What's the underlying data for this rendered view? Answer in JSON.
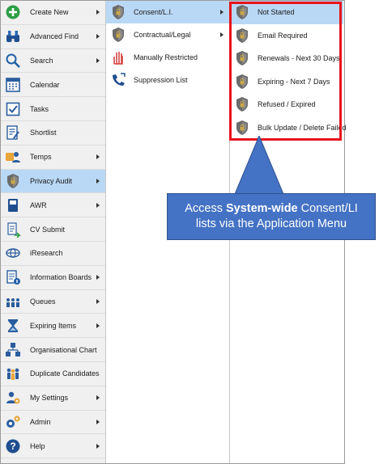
{
  "colors": {
    "selected": "#b9d8f5",
    "highlight_box": "#e8131c",
    "callout_bg": "#4472c4",
    "shield": "#6b6b6b"
  },
  "menu": [
    {
      "label": "Create New",
      "icon": "plus-circle-icon",
      "arrow": true
    },
    {
      "label": "Advanced Find",
      "icon": "binoculars-icon",
      "arrow": true
    },
    {
      "label": "Search",
      "icon": "magnifier-icon",
      "arrow": true
    },
    {
      "label": "Calendar",
      "icon": "calendar-icon",
      "arrow": false
    },
    {
      "label": "Tasks",
      "icon": "checkbox-icon",
      "arrow": false
    },
    {
      "label": "Shortlist",
      "icon": "shortlist-icon",
      "arrow": false
    },
    {
      "label": "Temps",
      "icon": "temps-icon",
      "arrow": true
    },
    {
      "label": "Privacy Audit",
      "icon": "shield-icon",
      "arrow": true,
      "selected": true
    },
    {
      "label": "AWR",
      "icon": "book-icon",
      "arrow": true
    },
    {
      "label": "CV Submit",
      "icon": "cv-submit-icon",
      "arrow": false
    },
    {
      "label": "iResearch",
      "icon": "globe-icon",
      "arrow": false
    },
    {
      "label": "Information Boards",
      "icon": "info-board-icon",
      "arrow": true
    },
    {
      "label": "Queues",
      "icon": "queue-icon",
      "arrow": true
    },
    {
      "label": "Expiring Items",
      "icon": "hourglass-icon",
      "arrow": true
    },
    {
      "label": "Organisational Chart",
      "icon": "org-chart-icon",
      "arrow": false
    },
    {
      "label": "Duplicate Candidates",
      "icon": "duplicate-people-icon",
      "arrow": false
    },
    {
      "label": "My Settings",
      "icon": "person-gear-icon",
      "arrow": true
    },
    {
      "label": "Admin",
      "icon": "gears-icon",
      "arrow": true
    },
    {
      "label": "Help",
      "icon": "help-icon",
      "arrow": true
    }
  ],
  "submenu": [
    {
      "label": "Consent/L.I.",
      "icon": "shield-icon",
      "arrow": true,
      "selected": true
    },
    {
      "label": "Contractual/Legal",
      "icon": "shield-icon",
      "arrow": true
    },
    {
      "label": "Manually Restricted",
      "icon": "restricted-hand-icon",
      "arrow": false
    },
    {
      "label": "Suppression List",
      "icon": "suppression-phone-icon",
      "arrow": false
    }
  ],
  "lists": [
    {
      "label": "Not Started",
      "icon": "shield-icon",
      "selected": true
    },
    {
      "label": "Email Required",
      "icon": "shield-icon"
    },
    {
      "label": "Renewals - Next 30 Days",
      "icon": "shield-icon"
    },
    {
      "label": "Expiring - Next 7 Days",
      "icon": "shield-icon"
    },
    {
      "label": "Refused / Expired",
      "icon": "shield-icon"
    },
    {
      "label": "Bulk Update / Delete Failed",
      "icon": "shield-icon"
    }
  ],
  "callout": {
    "prefix": "Access ",
    "bold": "System-wide",
    "middle": " Consent/LI",
    "line2": "lists via the Application Menu"
  }
}
